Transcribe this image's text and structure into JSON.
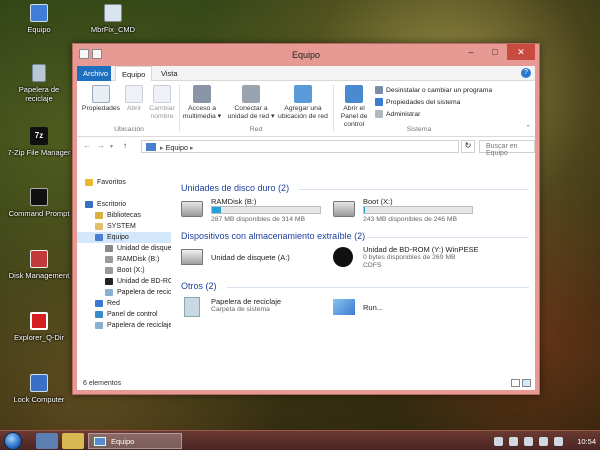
{
  "desktop": {
    "icons": [
      {
        "label": "Equipo",
        "color": "#3f7dd8"
      },
      {
        "label": "MbrFix_CMD",
        "color": "#d8e4ee"
      },
      {
        "label": "Papelera de reciclaje",
        "color": "#b8c8d4"
      },
      {
        "label": "7-Zip File Manager",
        "color": "#111111"
      },
      {
        "label": "Command Prompt",
        "color": "#111111"
      },
      {
        "label": "Disk Management",
        "color": "#c33a3a"
      },
      {
        "label": "Explorer_Q-Dir",
        "color": "#d42020"
      },
      {
        "label": "Lock Computer",
        "color": "#3a70c8"
      }
    ]
  },
  "taskbar": {
    "task_label": "Equipo",
    "clock": "10:54"
  },
  "window": {
    "title": "Equipo",
    "controls": {
      "minimize": "–",
      "maximize": "□",
      "close": "✕"
    },
    "tabs": {
      "file": "Archivo",
      "home": "Equipo",
      "view": "Vista"
    },
    "help": "?",
    "ribbon": {
      "location": {
        "group": "Ubicación",
        "items": [
          "Propiedades",
          "Abrir",
          "Cambiar nombre"
        ]
      },
      "network": {
        "group": "Red",
        "items": [
          "Acceso a multimedia ▾",
          "Conectar a unidad de red ▾",
          "Agregar una ubicación de red"
        ]
      },
      "system": {
        "group": "Sistema",
        "open_panel": "Abrir el Panel de control",
        "items": [
          "Desinstalar o cambiar un programa",
          "Propiedades del sistema",
          "Administrar"
        ]
      }
    },
    "address": {
      "back": "←",
      "forward": "→",
      "up": "↑",
      "path": "Equipo",
      "refresh": "↻",
      "search_placeholder": "Buscar en Equipo"
    },
    "nav_pane": [
      {
        "label": "Favoritos",
        "indent": 0,
        "icon_color": "#e8b830",
        "selected": false
      },
      {
        "label": "",
        "indent": 0,
        "icon_color": "",
        "selected": false
      },
      {
        "label": "Escritorio",
        "indent": 0,
        "icon_color": "#3a6fc6",
        "selected": false
      },
      {
        "label": "Bibliotecas",
        "indent": 1,
        "icon_color": "#d8b040",
        "selected": false
      },
      {
        "label": "SYSTEM",
        "indent": 1,
        "icon_color": "#e0c070",
        "selected": false
      },
      {
        "label": "Equipo",
        "indent": 1,
        "icon_color": "#4a7fd0",
        "selected": true
      },
      {
        "label": "Unidad de disquete",
        "indent": 2,
        "icon_color": "#888888",
        "selected": false
      },
      {
        "label": "RAMDisk (B:)",
        "indent": 2,
        "icon_color": "#9a9a9a",
        "selected": false
      },
      {
        "label": "Boot (X:)",
        "indent": 2,
        "icon_color": "#9a9a9a",
        "selected": false
      },
      {
        "label": "Unidad de BD-ROM",
        "indent": 2,
        "icon_color": "#222222",
        "selected": false
      },
      {
        "label": "Papelera de reciclaje",
        "indent": 2,
        "icon_color": "#8ab0d0",
        "selected": false
      },
      {
        "label": "Red",
        "indent": 1,
        "icon_color": "#3a7ad0",
        "selected": false
      },
      {
        "label": "Panel de control",
        "indent": 1,
        "icon_color": "#3a8ac8",
        "selected": false
      },
      {
        "label": "Papelera de reciclaje",
        "indent": 1,
        "icon_color": "#8ab0d0",
        "selected": false
      }
    ],
    "sections": {
      "hdd": {
        "header": "Unidades de disco duro (2)",
        "drives": [
          {
            "name": "RAMDisk (B:)",
            "free": "287 MB disponibles de 314 MB",
            "used_fraction": 0.086
          },
          {
            "name": "Boot (X:)",
            "free": "243 MB disponibles de 246 MB",
            "used_fraction": 0.012
          }
        ]
      },
      "removable": {
        "header": "Dispositivos con almacenamiento extraíble (2)",
        "items": [
          {
            "name": "Unidad de disquete (A:)",
            "line2": "",
            "line3": ""
          },
          {
            "name": "Unidad de BD-ROM (Y:) WinPESE",
            "line2": "0 bytes disponibles de 269 MB",
            "line3": "CDFS"
          }
        ]
      },
      "other": {
        "header": "Otros (2)",
        "items": [
          {
            "name": "Papelera de reciclaje",
            "sub": "Carpeta de sistema"
          },
          {
            "name": "Run...",
            "sub": ""
          }
        ]
      }
    },
    "status": "6 elementos"
  }
}
